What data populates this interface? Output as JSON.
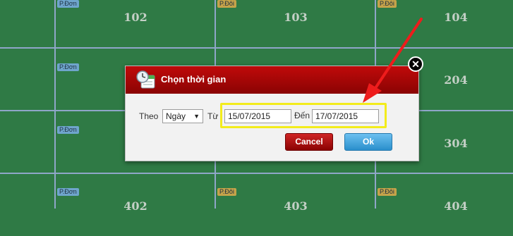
{
  "rooms": [
    {
      "number": "102",
      "badge": "P.Đơn",
      "type": "don"
    },
    {
      "number": "103",
      "badge": "P.Đôi",
      "type": "doi"
    },
    {
      "number": "104",
      "badge": "P.Đôi",
      "type": "doi"
    },
    {
      "number": "",
      "badge": "P.Đơn",
      "type": "don"
    },
    {
      "number": "",
      "badge": "",
      "type": ""
    },
    {
      "number": "204",
      "badge": "",
      "type": ""
    },
    {
      "number": "",
      "badge": "P.Đơn",
      "type": "don"
    },
    {
      "number": "",
      "badge": "",
      "type": ""
    },
    {
      "number": "304",
      "badge": "",
      "type": ""
    },
    {
      "number": "402",
      "badge": "P.Đơn",
      "type": "don"
    },
    {
      "number": "403",
      "badge": "P.Đôi",
      "type": "doi"
    },
    {
      "number": "404",
      "badge": "P.Đôi",
      "type": "doi"
    }
  ],
  "dialog": {
    "title": "Chọn thời gian",
    "close_symbol": "✕",
    "by_label": "Theo",
    "period_value": "Ngày",
    "from_label": "Từ",
    "from_date": "15/07/2015",
    "to_label": "Đến",
    "to_date": "17/07/2015",
    "cancel_label": "Cancel",
    "ok_label": "Ok"
  },
  "icons": {
    "dialog_icon": "calendar-clock-icon",
    "close_icon": "close-icon",
    "dropdown_icon": "chevron-down-icon"
  },
  "colors": {
    "grid_bg": "#2f7a45",
    "header_red": "#b00808",
    "highlight": "#f3ec1c",
    "arrow": "#ee1c1c"
  }
}
